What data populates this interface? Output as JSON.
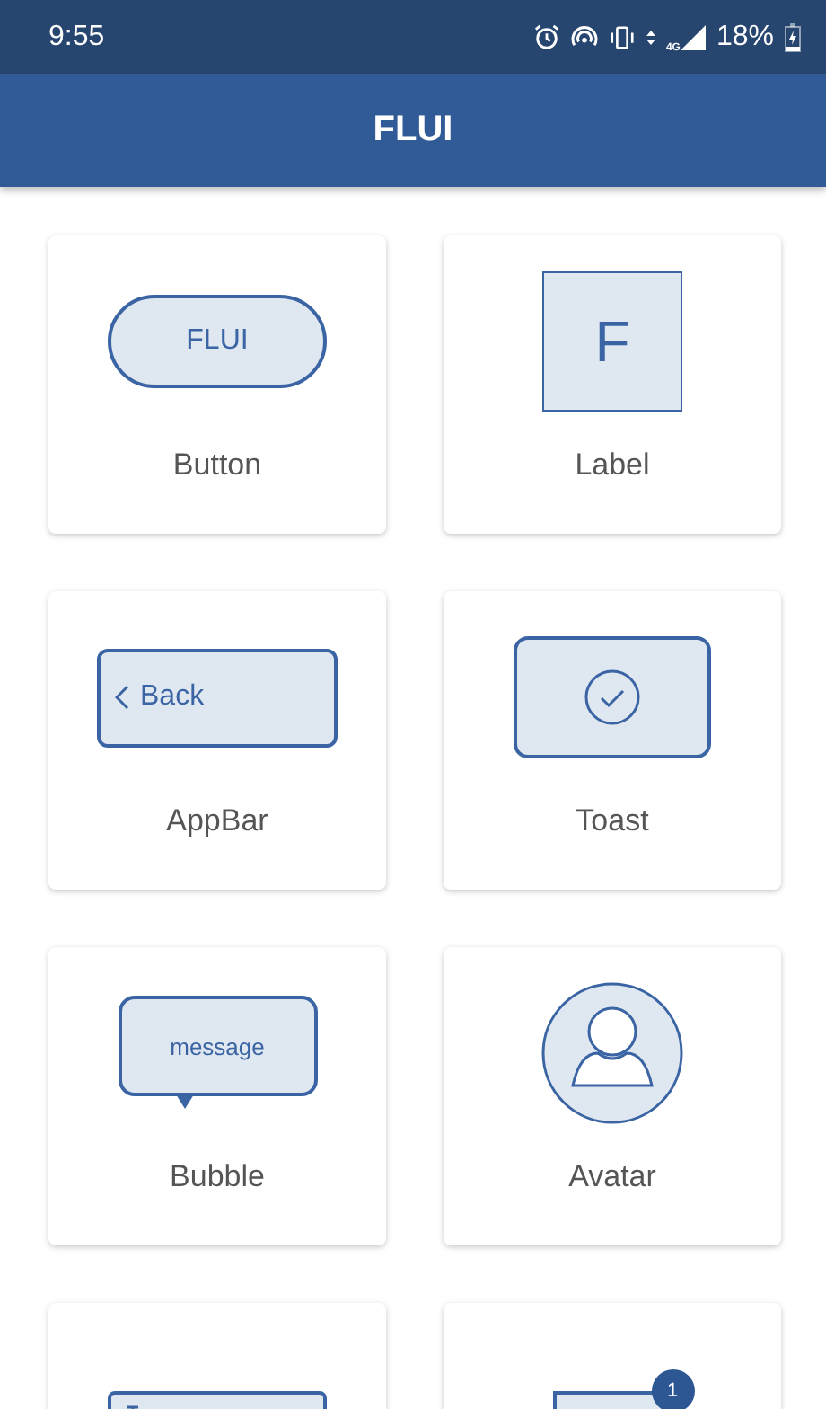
{
  "status_bar": {
    "time": "9:55",
    "network": "4G",
    "battery": "18%"
  },
  "app_bar": {
    "title": "FLUI"
  },
  "widgets": [
    {
      "kind": "button",
      "preview_text": "FLUI",
      "caption": "Button"
    },
    {
      "kind": "label",
      "preview_text": "F",
      "caption": "Label"
    },
    {
      "kind": "appbar",
      "preview_text": "Back",
      "caption": "AppBar"
    },
    {
      "kind": "toast",
      "caption": "Toast"
    },
    {
      "kind": "bubble",
      "preview_text": "message",
      "caption": "Bubble"
    },
    {
      "kind": "avatar",
      "caption": "Avatar"
    },
    {
      "kind": "textfield"
    },
    {
      "kind": "badge",
      "preview_text": "1"
    }
  ]
}
